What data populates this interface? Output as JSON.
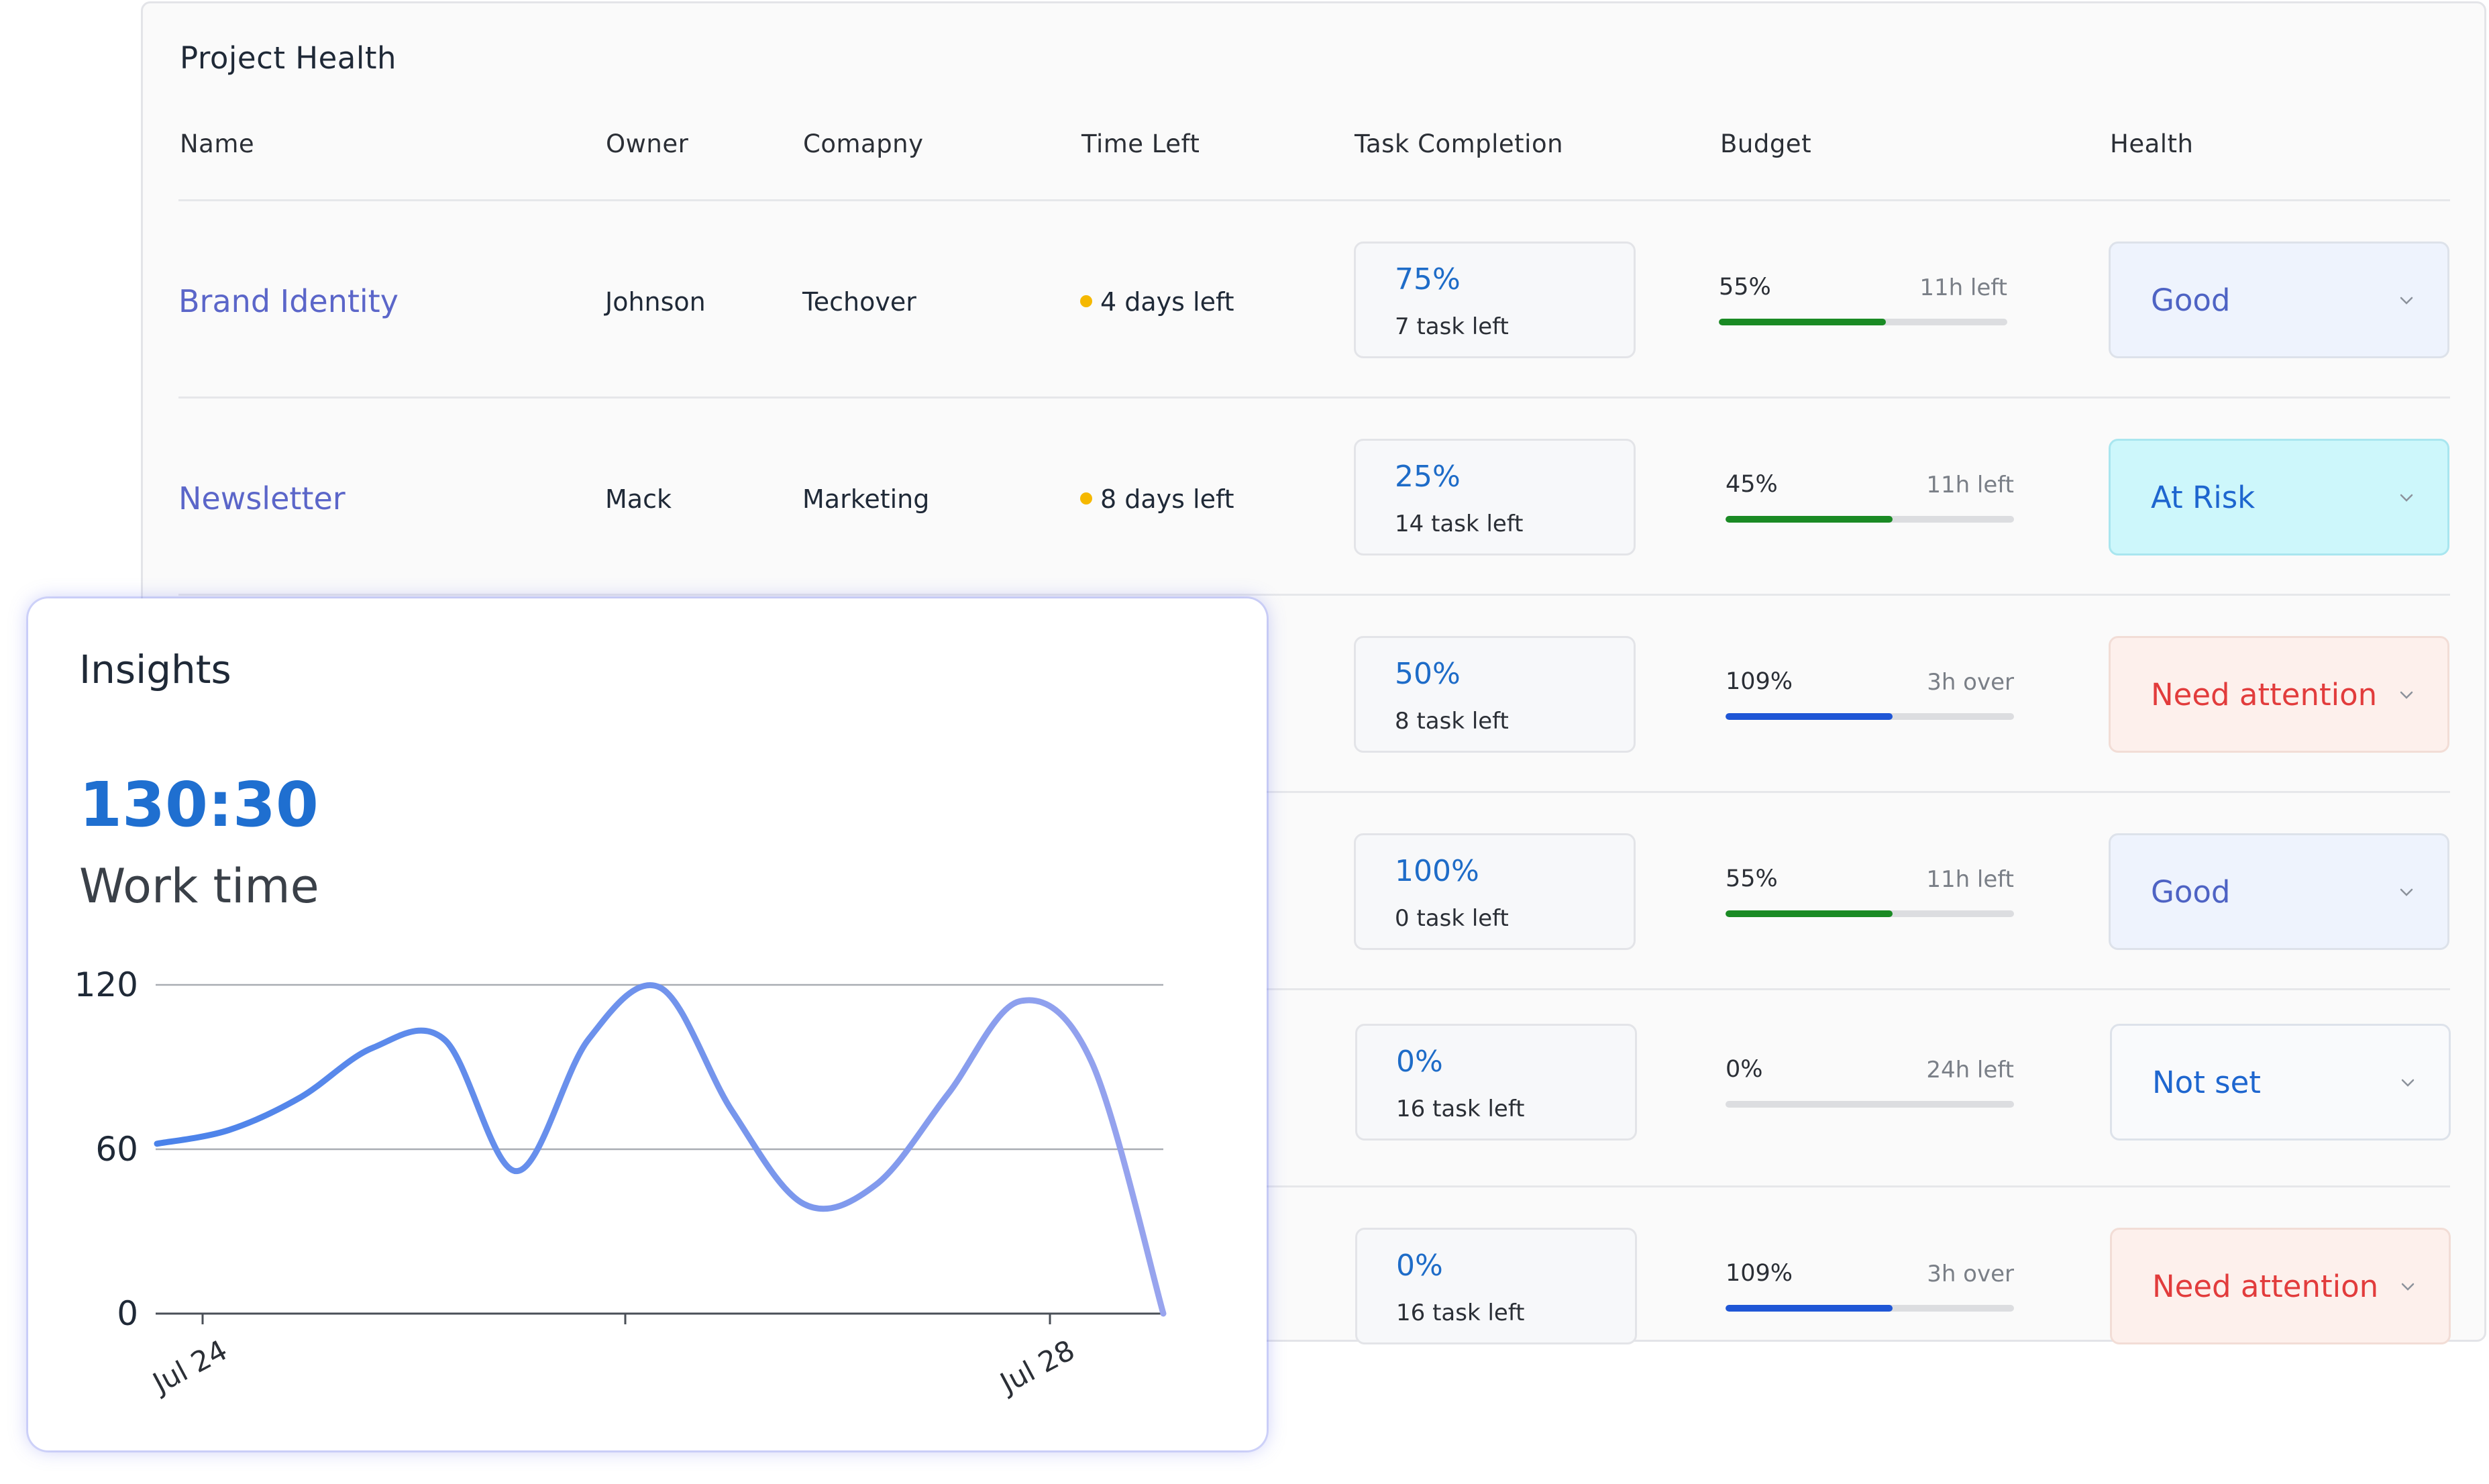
{
  "project_health": {
    "title": "Project Health",
    "columns": [
      "Name",
      "Owner",
      "Comapny",
      "Time Left",
      "Task Completion",
      "Budget",
      "Health"
    ],
    "rows": [
      {
        "name": "Brand Identity",
        "owner": "Johnson",
        "company": "Techover",
        "time_left": "4 days left",
        "task_pct": "75%",
        "task_left": "7 task left",
        "budget_pct": "55%",
        "budget_note": "11h left",
        "budget_fill": 0.58,
        "budget_color": "#1a8a24",
        "health": "Good",
        "health_style": "good"
      },
      {
        "name": "Newsletter",
        "owner": "Mack",
        "company": "Marketing",
        "time_left": "8 days left",
        "task_pct": "25%",
        "task_left": "14 task left",
        "budget_pct": "45%",
        "budget_note": "11h left",
        "budget_fill": 0.58,
        "budget_color": "#1a8a24",
        "health": "At Risk",
        "health_style": "risk"
      },
      {
        "name": "",
        "owner": "",
        "company": "",
        "time_left": "",
        "task_pct": "50%",
        "task_left": "8 task left",
        "budget_pct": "109%",
        "budget_note": "3h over",
        "budget_fill": 0.58,
        "budget_color": "#1f56d6",
        "health": "Need attention",
        "health_style": "attention"
      },
      {
        "name": "",
        "owner": "",
        "company": "",
        "time_left": "",
        "task_pct": "100%",
        "task_left": "0 task left",
        "budget_pct": "55%",
        "budget_note": "11h left",
        "budget_fill": 0.58,
        "budget_color": "#1a8a24",
        "health": "Good",
        "health_style": "good"
      },
      {
        "name": "",
        "owner": "",
        "company": "",
        "time_left": "",
        "task_pct": "0%",
        "task_left": "16 task left",
        "budget_pct": "0%",
        "budget_note": "24h left",
        "budget_fill": 0.0,
        "budget_color": "#1a8a24",
        "health": "Not set",
        "health_style": "notset"
      },
      {
        "name": "",
        "owner": "",
        "company": "",
        "time_left": "",
        "task_pct": "0%",
        "task_left": "16 task left",
        "budget_pct": "109%",
        "budget_note": "3h over",
        "budget_fill": 0.58,
        "budget_color": "#1f56d6",
        "health": "Need attention",
        "health_style": "attention"
      }
    ]
  },
  "insights": {
    "title": "Insights",
    "work_value": "130:30",
    "work_label": "Work time"
  },
  "chart_data": {
    "type": "line",
    "title": "",
    "xlabel": "",
    "ylabel": "",
    "x_tick_labels": [
      "Jul 24",
      "",
      "Jul 28"
    ],
    "y_ticks": [
      0,
      60,
      120
    ],
    "ylim": [
      0,
      120
    ],
    "grid": true,
    "series": [
      {
        "values": [
          62,
          67,
          79,
          97,
          100,
          52,
          100,
          119,
          74,
          40,
          47,
          80,
          114,
          92,
          0
        ]
      }
    ],
    "line_color_start": "#4a82ea",
    "line_color_end": "#98a4ee"
  },
  "colors": {
    "good_bg": "#eef3fd",
    "good_text": "#4e63c4",
    "risk_bg": "#cdf7fb",
    "risk_text": "#1e66cf",
    "attention_bg": "#fdf0ec",
    "attention_text": "#e23c3c",
    "notset_bg": "#f9fafc",
    "notset_text": "#1e66cf"
  }
}
